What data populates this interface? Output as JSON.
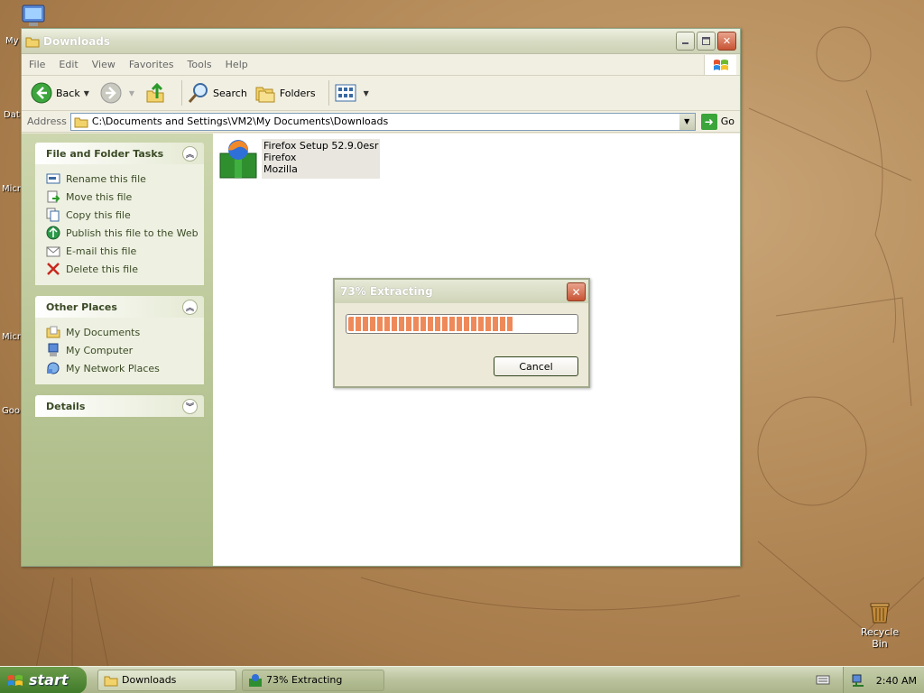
{
  "desktop": {
    "icons": [
      {
        "label": "My",
        "icon": "my-computer-icon"
      },
      {
        "label": "Dat",
        "icon": "folder-icon"
      },
      {
        "label": "Micro",
        "icon": "app-icon"
      },
      {
        "label": "Micro B",
        "icon": "app-icon"
      },
      {
        "label": "Goo",
        "icon": "app-icon"
      },
      {
        "label": "Recycle Bin",
        "icon": "recycle-bin-icon"
      }
    ]
  },
  "window": {
    "title": "Downloads",
    "menu": [
      "File",
      "Edit",
      "View",
      "Favorites",
      "Tools",
      "Help"
    ],
    "toolbar": {
      "back": "Back",
      "search": "Search",
      "folders": "Folders"
    },
    "address": {
      "label": "Address",
      "value": "C:\\Documents and Settings\\VM2\\My Documents\\Downloads",
      "go": "Go"
    },
    "tasks": {
      "title": "File and Folder Tasks",
      "items": [
        "Rename this file",
        "Move this file",
        "Copy this file",
        "Publish this file to the Web",
        "E-mail this file",
        "Delete this file"
      ]
    },
    "places": {
      "title": "Other Places",
      "items": [
        "My Documents",
        "My Computer",
        "My Network Places"
      ]
    },
    "details": {
      "title": "Details"
    },
    "file": {
      "name": "Firefox Setup 52.9.0esr",
      "line2": "Firefox",
      "line3": "Mozilla"
    }
  },
  "dialog": {
    "title": "73% Extracting",
    "progress_percent": 73,
    "cancel": "Cancel"
  },
  "taskbar": {
    "start": "start",
    "tasks": [
      "Downloads",
      "73% Extracting"
    ],
    "clock": "2:40 AM"
  }
}
